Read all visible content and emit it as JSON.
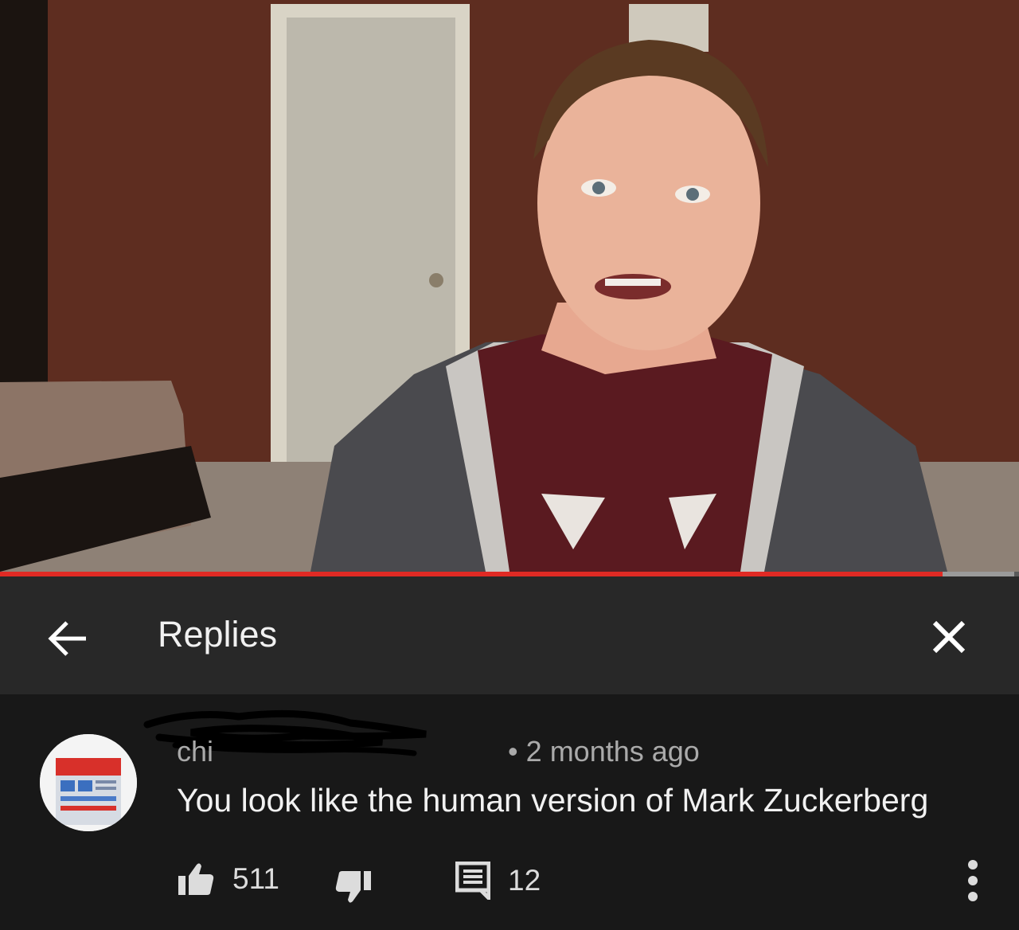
{
  "video": {
    "progress_fraction": 0.925,
    "buffer_fraction": 0.995,
    "colors": {
      "played": "#e02a24",
      "buffered": "#9a9a9a",
      "track": "#5a5a5a"
    }
  },
  "header": {
    "back_icon": "arrow-left-icon",
    "title": "Replies",
    "close_icon": "close-icon"
  },
  "comment": {
    "author_visible": "chi          ",
    "separator": "•",
    "timestamp": "2 months ago",
    "text": "You look like the human version of Mark Zuckerberg",
    "likes": "511",
    "replies": "12",
    "icons": {
      "like": "thumb-up-icon",
      "dislike": "thumb-down-icon",
      "reply": "comment-icon",
      "more": "more-vertical-icon"
    }
  }
}
